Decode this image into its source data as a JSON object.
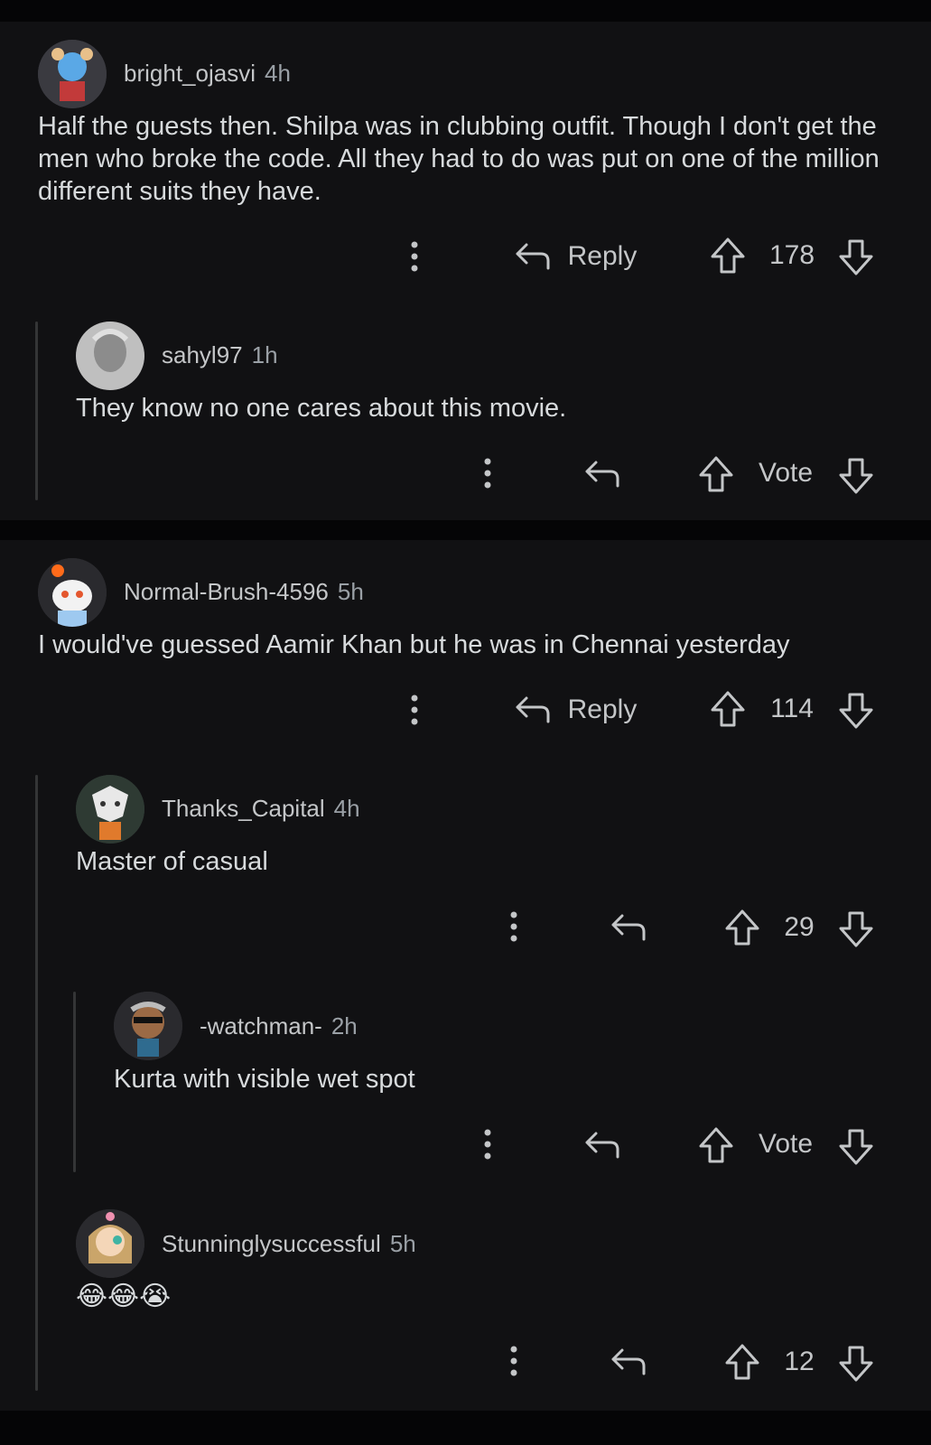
{
  "comments": [
    {
      "username": "bright_ojasvi",
      "age": "4h",
      "body": "Half the guests then. Shilpa was in clubbing outfit. Though I don't get the men who broke the code. All they had to do was put on one of the million different suits they have.",
      "reply_label": "Reply",
      "vote": "178"
    },
    {
      "username": "sahyl97",
      "age": "1h",
      "body": "They know no one cares about this movie.",
      "vote": "Vote"
    },
    {
      "username": "Normal-Brush-4596",
      "age": "5h",
      "body": "I would've guessed Aamir Khan but he was in Chennai yesterday",
      "reply_label": "Reply",
      "vote": "114"
    },
    {
      "username": "Thanks_Capital",
      "age": "4h",
      "body": "Master of casual",
      "vote": "29"
    },
    {
      "username": "-watchman-",
      "age": "2h",
      "body": "Kurta with visible wet spot",
      "vote": "Vote"
    },
    {
      "username": "Stunninglysuccessful",
      "age": "5h",
      "body": "😂😂😭",
      "vote": "12"
    }
  ],
  "icons": {
    "more": "more-vertical-icon",
    "reply": "reply-arrow-icon",
    "upvote": "upvote-arrow-icon",
    "downvote": "downvote-arrow-icon"
  },
  "colors": {
    "background": "#0b0b0d",
    "card": "#111113",
    "text": "#d7dadc",
    "meta": "#9aa0a6",
    "thread_line": "#343536"
  }
}
